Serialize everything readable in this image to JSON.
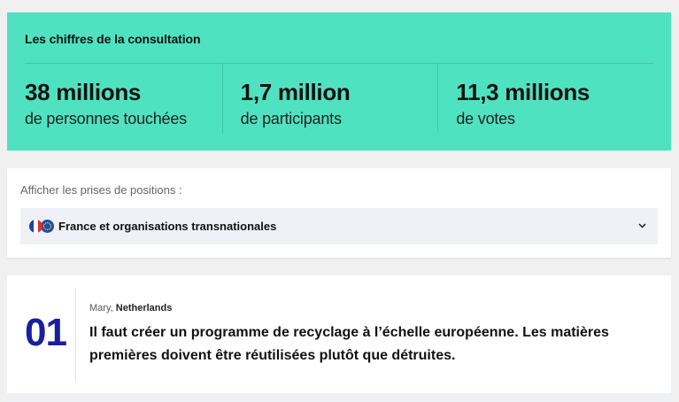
{
  "stats": {
    "title": "Les chiffres de la consultation",
    "items": [
      {
        "value": "38 millions",
        "label": "de personnes touchées"
      },
      {
        "value": "1,7 million",
        "label": "de participants"
      },
      {
        "value": "11,3 millions",
        "label": "de votes"
      }
    ],
    "background_color": "#4fe2c1"
  },
  "filter": {
    "label": "Afficher les prises de positions :",
    "selected": "France et organisations transnationales",
    "icons": [
      "france-flag-icon",
      "eu-flag-icon",
      "chevron-down-icon"
    ]
  },
  "proposal": {
    "number": "01",
    "author": "Mary",
    "country": "Netherlands",
    "text": "Il faut créer un programme de recyclage à l’échelle européenne. Les matières premières doivent être réutilisées plutôt que détruites.",
    "number_color": "#1a1f9c"
  }
}
